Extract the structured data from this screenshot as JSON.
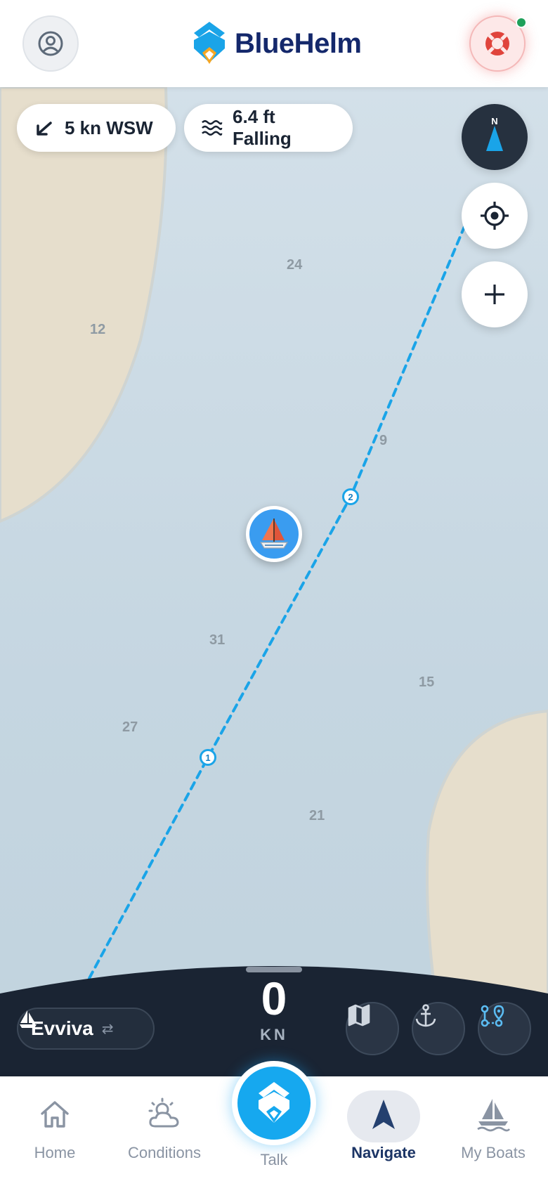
{
  "header": {
    "brand_name": "BlueHelm"
  },
  "conditions": {
    "wind": "5 kn WSW",
    "tide": "6.4 ft Falling"
  },
  "compass": {
    "north_label": "N"
  },
  "map": {
    "depths": [
      "24",
      "12",
      "9",
      "31",
      "15",
      "27",
      "21"
    ],
    "waypoints": [
      "1",
      "2"
    ]
  },
  "vessel": {
    "name": "Evviva",
    "swap_glyph": "⇄"
  },
  "speed": {
    "value": "0",
    "unit": "KN"
  },
  "nav": {
    "home": "Home",
    "conditions": "Conditions",
    "talk": "Talk",
    "navigate": "Navigate",
    "my_boats": "My Boats"
  },
  "colors": {
    "brand": "#14286b",
    "accent": "#16a8ef",
    "route": "#1aa4e8",
    "land": "#e6decc",
    "panel": "#1a2433",
    "online": "#1fa05a"
  }
}
